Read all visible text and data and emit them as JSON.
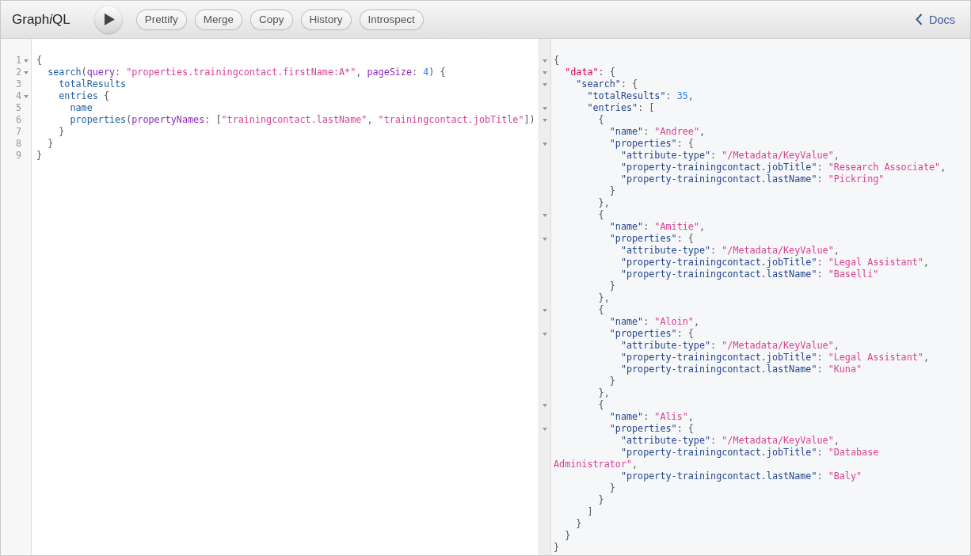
{
  "toolbar": {
    "title_parts": [
      {
        "text": "Graph",
        "italic": false
      },
      {
        "text": "i",
        "italic": true
      },
      {
        "text": "QL",
        "italic": false
      }
    ],
    "buttons": [
      "Prettify",
      "Merge",
      "Copy",
      "History",
      "Introspect"
    ],
    "docs_link": "Docs"
  },
  "query_editor": {
    "lines": [
      {
        "number": "1",
        "expanded": true,
        "tokens": [
          {
            "kind": "punct",
            "text": "{"
          }
        ],
        "children": [
          {
            "number": "2",
            "expanded": true,
            "tokens": [
              {
                "kind": "field",
                "text": "search"
              },
              {
                "kind": "punct",
                "text": "("
              },
              {
                "kind": "argument",
                "text": "query"
              },
              {
                "kind": "punct",
                "text": ": "
              },
              {
                "kind": "string",
                "text": "\"properties.trainingcontact.firstName:A*\""
              },
              {
                "kind": "punct",
                "text": ", "
              },
              {
                "kind": "argument",
                "text": "pageSize"
              },
              {
                "kind": "punct",
                "text": ": "
              },
              {
                "kind": "number",
                "text": "4"
              },
              {
                "kind": "punct",
                "text": ") {"
              }
            ],
            "children": [
              {
                "number": "3",
                "tokens": [
                  {
                    "kind": "field",
                    "text": "totalResults"
                  }
                ]
              },
              {
                "number": "4",
                "expanded": true,
                "tokens": [
                  {
                    "kind": "field",
                    "text": "entries"
                  },
                  {
                    "kind": "punct",
                    "text": " {"
                  }
                ],
                "children": [
                  {
                    "number": "5",
                    "tokens": [
                      {
                        "kind": "field",
                        "text": "name"
                      }
                    ]
                  },
                  {
                    "number": "6",
                    "tokens": [
                      {
                        "kind": "field",
                        "text": "properties"
                      },
                      {
                        "kind": "punct",
                        "text": "("
                      },
                      {
                        "kind": "argument",
                        "text": "propertyNames"
                      },
                      {
                        "kind": "punct",
                        "text": ": ["
                      },
                      {
                        "kind": "string",
                        "text": "\"trainingcontact.lastName\""
                      },
                      {
                        "kind": "punct",
                        "text": ", "
                      },
                      {
                        "kind": "string",
                        "text": "\"trainingcontact.jobTitle\""
                      },
                      {
                        "kind": "punct",
                        "text": "])"
                      }
                    ]
                  }
                ]
              },
              {
                "number": "7",
                "tokens": [
                  {
                    "kind": "punct",
                    "text": "}"
                  }
                ]
              }
            ]
          },
          {
            "number": "8",
            "tokens": [
              {
                "kind": "punct",
                "text": "}"
              }
            ]
          }
        ]
      },
      {
        "number": "9",
        "tokens": [
          {
            "kind": "punct",
            "text": "}"
          }
        ]
      }
    ]
  },
  "result_viewer": {
    "lines": [
      {
        "expanded": true,
        "tokens": [
          {
            "kind": "punct",
            "text": "{"
          }
        ],
        "children": [
          {
            "expanded": true,
            "tokens": [
              {
                "kind": "def",
                "text": "\"data\""
              },
              {
                "kind": "punct",
                "text": ": {"
              }
            ],
            "children": [
              {
                "expanded": true,
                "tokens": [
                  {
                    "kind": "key",
                    "text": "\"search\""
                  },
                  {
                    "kind": "punct",
                    "text": ": {"
                  }
                ],
                "children": [
                  {
                    "tokens": [
                      {
                        "kind": "key",
                        "text": "\"totalResults\""
                      },
                      {
                        "kind": "punct",
                        "text": ": "
                      },
                      {
                        "kind": "number",
                        "text": "35"
                      },
                      {
                        "kind": "punct",
                        "text": ","
                      }
                    ]
                  },
                  {
                    "expanded": true,
                    "tokens": [
                      {
                        "kind": "key",
                        "text": "\"entries\""
                      },
                      {
                        "kind": "punct",
                        "text": ": ["
                      }
                    ],
                    "children": [
                      {
                        "expanded": true,
                        "tokens": [
                          {
                            "kind": "punct",
                            "text": "{"
                          }
                        ],
                        "children": [
                          {
                            "tokens": [
                              {
                                "kind": "key",
                                "text": "\"name\""
                              },
                              {
                                "kind": "punct",
                                "text": ": "
                              },
                              {
                                "kind": "string",
                                "text": "\"Andree\""
                              },
                              {
                                "kind": "punct",
                                "text": ","
                              }
                            ]
                          },
                          {
                            "expanded": true,
                            "tokens": [
                              {
                                "kind": "key",
                                "text": "\"properties\""
                              },
                              {
                                "kind": "punct",
                                "text": ": {"
                              }
                            ],
                            "children": [
                              {
                                "tokens": [
                                  {
                                    "kind": "key",
                                    "text": "\"attribute-type\""
                                  },
                                  {
                                    "kind": "punct",
                                    "text": ": "
                                  },
                                  {
                                    "kind": "string",
                                    "text": "\"/Metadata/KeyValue\""
                                  },
                                  {
                                    "kind": "punct",
                                    "text": ","
                                  }
                                ]
                              },
                              {
                                "tokens": [
                                  {
                                    "kind": "key",
                                    "text": "\"property-trainingcontact.jobTitle\""
                                  },
                                  {
                                    "kind": "punct",
                                    "text": ": "
                                  },
                                  {
                                    "kind": "string",
                                    "text": "\"Research Associate\""
                                  },
                                  {
                                    "kind": "punct",
                                    "text": ","
                                  }
                                ]
                              },
                              {
                                "tokens": [
                                  {
                                    "kind": "key",
                                    "text": "\"property-trainingcontact.lastName\""
                                  },
                                  {
                                    "kind": "punct",
                                    "text": ": "
                                  },
                                  {
                                    "kind": "string",
                                    "text": "\"Pickring\""
                                  }
                                ]
                              }
                            ]
                          },
                          {
                            "tokens": [
                              {
                                "kind": "punct",
                                "text": "}"
                              }
                            ]
                          }
                        ]
                      },
                      {
                        "tokens": [
                          {
                            "kind": "punct",
                            "text": "},"
                          }
                        ]
                      },
                      {
                        "expanded": true,
                        "tokens": [
                          {
                            "kind": "punct",
                            "text": "{"
                          }
                        ],
                        "children": [
                          {
                            "tokens": [
                              {
                                "kind": "key",
                                "text": "\"name\""
                              },
                              {
                                "kind": "punct",
                                "text": ": "
                              },
                              {
                                "kind": "string",
                                "text": "\"Amitie\""
                              },
                              {
                                "kind": "punct",
                                "text": ","
                              }
                            ]
                          },
                          {
                            "expanded": true,
                            "tokens": [
                              {
                                "kind": "key",
                                "text": "\"properties\""
                              },
                              {
                                "kind": "punct",
                                "text": ": {"
                              }
                            ],
                            "children": [
                              {
                                "tokens": [
                                  {
                                    "kind": "key",
                                    "text": "\"attribute-type\""
                                  },
                                  {
                                    "kind": "punct",
                                    "text": ": "
                                  },
                                  {
                                    "kind": "string",
                                    "text": "\"/Metadata/KeyValue\""
                                  },
                                  {
                                    "kind": "punct",
                                    "text": ","
                                  }
                                ]
                              },
                              {
                                "tokens": [
                                  {
                                    "kind": "key",
                                    "text": "\"property-trainingcontact.jobTitle\""
                                  },
                                  {
                                    "kind": "punct",
                                    "text": ": "
                                  },
                                  {
                                    "kind": "string",
                                    "text": "\"Legal Assistant\""
                                  },
                                  {
                                    "kind": "punct",
                                    "text": ","
                                  }
                                ]
                              },
                              {
                                "tokens": [
                                  {
                                    "kind": "key",
                                    "text": "\"property-trainingcontact.lastName\""
                                  },
                                  {
                                    "kind": "punct",
                                    "text": ": "
                                  },
                                  {
                                    "kind": "string",
                                    "text": "\"Baselli\""
                                  }
                                ]
                              }
                            ]
                          },
                          {
                            "tokens": [
                              {
                                "kind": "punct",
                                "text": "}"
                              }
                            ]
                          }
                        ]
                      },
                      {
                        "tokens": [
                          {
                            "kind": "punct",
                            "text": "},"
                          }
                        ]
                      },
                      {
                        "expanded": true,
                        "tokens": [
                          {
                            "kind": "punct",
                            "text": "{"
                          }
                        ],
                        "children": [
                          {
                            "tokens": [
                              {
                                "kind": "key",
                                "text": "\"name\""
                              },
                              {
                                "kind": "punct",
                                "text": ": "
                              },
                              {
                                "kind": "string",
                                "text": "\"Aloin\""
                              },
                              {
                                "kind": "punct",
                                "text": ","
                              }
                            ]
                          },
                          {
                            "expanded": true,
                            "tokens": [
                              {
                                "kind": "key",
                                "text": "\"properties\""
                              },
                              {
                                "kind": "punct",
                                "text": ": {"
                              }
                            ],
                            "children": [
                              {
                                "tokens": [
                                  {
                                    "kind": "key",
                                    "text": "\"attribute-type\""
                                  },
                                  {
                                    "kind": "punct",
                                    "text": ": "
                                  },
                                  {
                                    "kind": "string",
                                    "text": "\"/Metadata/KeyValue\""
                                  },
                                  {
                                    "kind": "punct",
                                    "text": ","
                                  }
                                ]
                              },
                              {
                                "tokens": [
                                  {
                                    "kind": "key",
                                    "text": "\"property-trainingcontact.jobTitle\""
                                  },
                                  {
                                    "kind": "punct",
                                    "text": ": "
                                  },
                                  {
                                    "kind": "string",
                                    "text": "\"Legal Assistant\""
                                  },
                                  {
                                    "kind": "punct",
                                    "text": ","
                                  }
                                ]
                              },
                              {
                                "tokens": [
                                  {
                                    "kind": "key",
                                    "text": "\"property-trainingcontact.lastName\""
                                  },
                                  {
                                    "kind": "punct",
                                    "text": ": "
                                  },
                                  {
                                    "kind": "string",
                                    "text": "\"Kuna\""
                                  }
                                ]
                              }
                            ]
                          },
                          {
                            "tokens": [
                              {
                                "kind": "punct",
                                "text": "}"
                              }
                            ]
                          }
                        ]
                      },
                      {
                        "tokens": [
                          {
                            "kind": "punct",
                            "text": "},"
                          }
                        ]
                      },
                      {
                        "expanded": true,
                        "tokens": [
                          {
                            "kind": "punct",
                            "text": "{"
                          }
                        ],
                        "children": [
                          {
                            "tokens": [
                              {
                                "kind": "key",
                                "text": "\"name\""
                              },
                              {
                                "kind": "punct",
                                "text": ": "
                              },
                              {
                                "kind": "string",
                                "text": "\"Alis\""
                              },
                              {
                                "kind": "punct",
                                "text": ","
                              }
                            ]
                          },
                          {
                            "expanded": true,
                            "tokens": [
                              {
                                "kind": "key",
                                "text": "\"properties\""
                              },
                              {
                                "kind": "punct",
                                "text": ": {"
                              }
                            ],
                            "children": [
                              {
                                "tokens": [
                                  {
                                    "kind": "key",
                                    "text": "\"attribute-type\""
                                  },
                                  {
                                    "kind": "punct",
                                    "text": ": "
                                  },
                                  {
                                    "kind": "string",
                                    "text": "\"/Metadata/KeyValue\""
                                  },
                                  {
                                    "kind": "punct",
                                    "text": ","
                                  }
                                ]
                              },
                              {
                                "tokens": [
                                  {
                                    "kind": "key",
                                    "text": "\"property-trainingcontact.jobTitle\""
                                  },
                                  {
                                    "kind": "punct",
                                    "text": ": "
                                  },
                                  {
                                    "kind": "string",
                                    "text": "\"Database Administrator\""
                                  },
                                  {
                                    "kind": "punct",
                                    "text": ","
                                  }
                                ]
                              },
                              {
                                "tokens": [
                                  {
                                    "kind": "key",
                                    "text": "\"property-trainingcontact.lastName\""
                                  },
                                  {
                                    "kind": "punct",
                                    "text": ": "
                                  },
                                  {
                                    "kind": "string",
                                    "text": "\"Baly\""
                                  }
                                ]
                              }
                            ]
                          },
                          {
                            "tokens": [
                              {
                                "kind": "punct",
                                "text": "}"
                              }
                            ]
                          }
                        ]
                      },
                      {
                        "tokens": [
                          {
                            "kind": "punct",
                            "text": "}"
                          }
                        ]
                      }
                    ]
                  },
                  {
                    "tokens": [
                      {
                        "kind": "punct",
                        "text": "]"
                      }
                    ]
                  }
                ]
              },
              {
                "tokens": [
                  {
                    "kind": "punct",
                    "text": "}"
                  }
                ]
              }
            ]
          },
          {
            "tokens": [
              {
                "kind": "punct",
                "text": "}"
              }
            ]
          }
        ]
      },
      {
        "tokens": [
          {
            "kind": "punct",
            "text": "}"
          }
        ]
      }
    ]
  }
}
